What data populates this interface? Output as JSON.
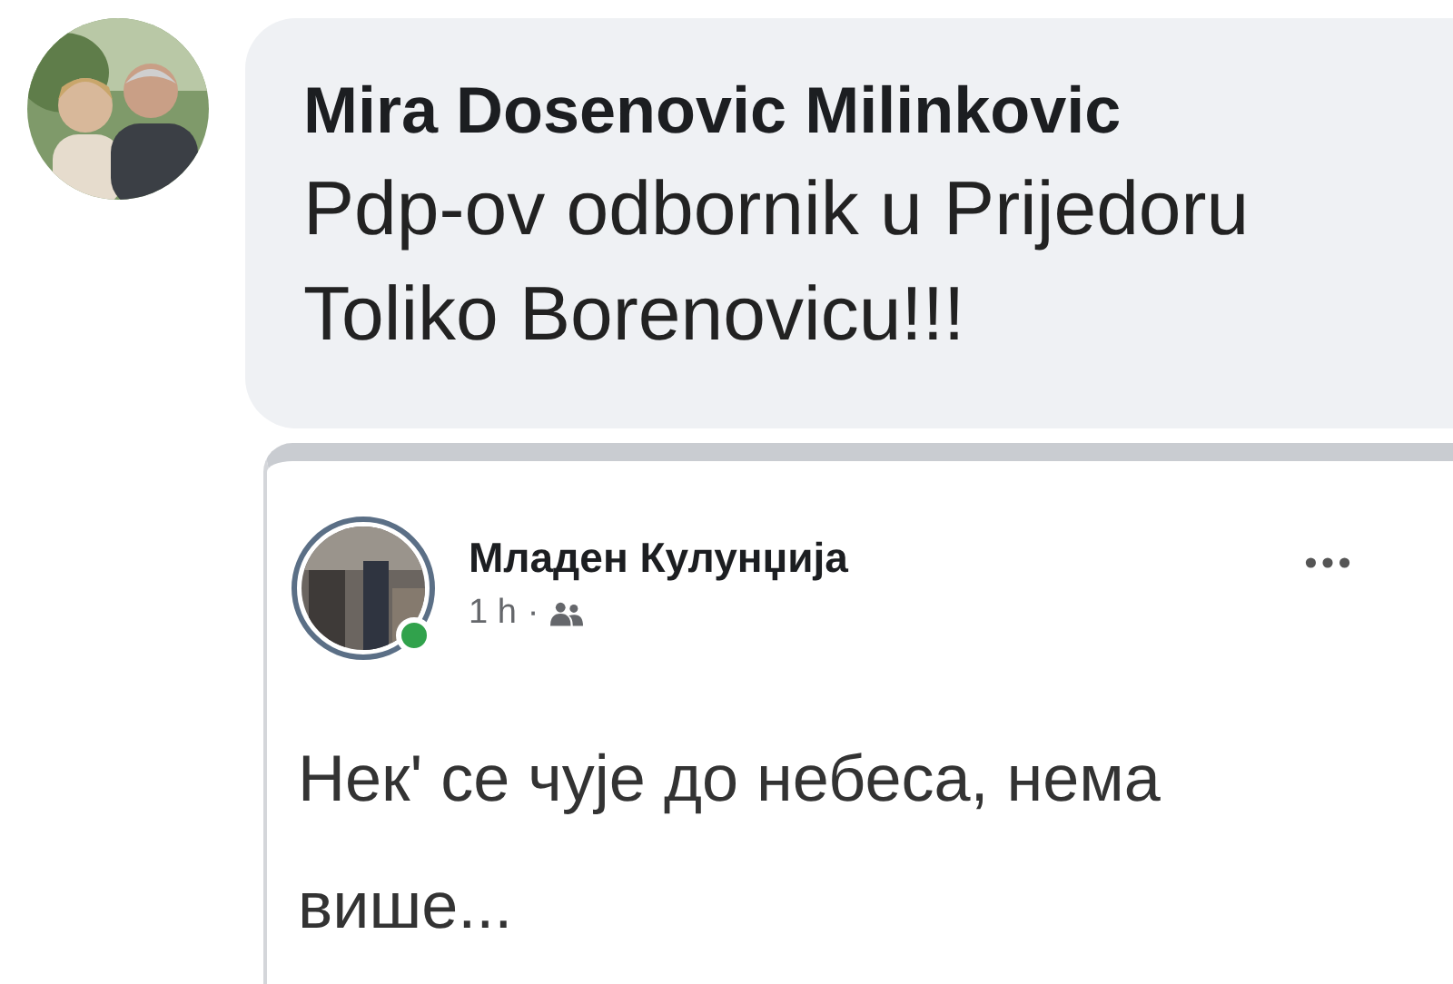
{
  "comment": {
    "author": "Mira Dosenovic Milinkovic",
    "text": "Pdp-ov odbornik u Prijedoru\nToliko Borenovicu!!!"
  },
  "shared_post": {
    "author": "Младен Кулунџија",
    "online": true,
    "time": "1 h",
    "separator": "·",
    "text": "Нек' се чује до небеса, нема\nвише..."
  }
}
